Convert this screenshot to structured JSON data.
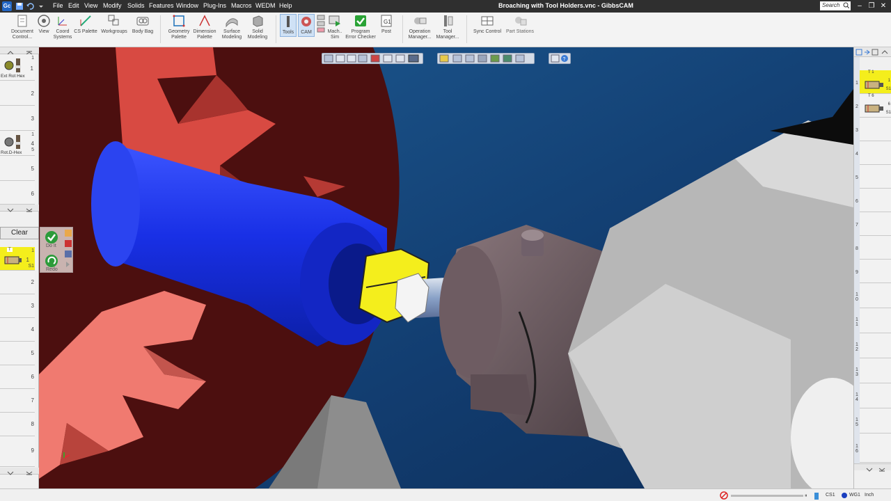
{
  "app": {
    "title": "Broaching with Tool Holders.vnc - GibbsCAM"
  },
  "menu": [
    "File",
    "Edit",
    "View",
    "Modify",
    "Solids",
    "Features",
    "Window",
    "Plug-Ins",
    "Macros",
    "WEDM",
    "Help"
  ],
  "search": {
    "placeholder": "Search"
  },
  "ribbon": {
    "tools": [
      {
        "label1": "Document",
        "label2": "Control...",
        "icon": "document-control-icon"
      },
      {
        "label1": "View",
        "label2": "",
        "icon": "view-icon"
      },
      {
        "label1": "Coord",
        "label2": "Systems",
        "icon": "coord-systems-icon"
      },
      {
        "label1": "CS Palette",
        "label2": "",
        "icon": "cs-palette-icon"
      },
      {
        "label1": "Workgroups",
        "label2": "",
        "icon": "workgroups-icon"
      },
      {
        "label1": "Body Bag",
        "label2": "",
        "icon": "body-bag-icon"
      },
      {
        "label1": "Geometry",
        "label2": "Palette",
        "icon": "geometry-palette-icon"
      },
      {
        "label1": "Dimension",
        "label2": "Palette",
        "icon": "dimension-palette-icon"
      },
      {
        "label1": "Surface",
        "label2": "Modeling",
        "icon": "surface-modeling-icon"
      },
      {
        "label1": "Solid",
        "label2": "Modeling",
        "icon": "solid-modeling-icon"
      },
      {
        "label1": "Tools",
        "label2": "",
        "icon": "tools-icon"
      },
      {
        "label1": "CAM",
        "label2": "",
        "icon": "cam-icon"
      },
      {
        "label1": "Mach..",
        "label2": "Sim",
        "icon": "machine-sim-icon"
      },
      {
        "label1": "Program",
        "label2": "Error Checker",
        "icon": "program-error-checker-icon"
      },
      {
        "label1": "Post",
        "label2": "",
        "icon": "post-icon"
      },
      {
        "label1": "Operation",
        "label2": "Manager...",
        "icon": "operation-manager-icon"
      },
      {
        "label1": "Tool",
        "label2": "Manager...",
        "icon": "tool-manager-icon"
      },
      {
        "label1": "Sync Control",
        "label2": "",
        "icon": "sync-control-icon"
      },
      {
        "label1": "Part Stations",
        "label2": "",
        "icon": "part-stations-icon"
      }
    ]
  },
  "left_tools": {
    "slots": [
      {
        "num": "1",
        "tool_label": "Ext Rot Hex",
        "small_num": "1"
      },
      {
        "num": "2"
      },
      {
        "num": "3"
      },
      {
        "num": "4",
        "tool_label": "Rot.D-Hex",
        "small_nums": [
          "1",
          "5"
        ]
      },
      {
        "num": "5"
      },
      {
        "num": "6"
      }
    ]
  },
  "process": {
    "clear_label": "Clear",
    "doit_label": "Do It",
    "redo_label": "Redo",
    "slots": [
      "1",
      "2",
      "3",
      "4",
      "5",
      "6",
      "7",
      "8",
      "9"
    ],
    "item": {
      "top": "T",
      "num": "1",
      "side": "1",
      "s": "S1"
    }
  },
  "right_tools": {
    "slots": [
      {
        "num": "1",
        "t": "T 1",
        "sub": "1",
        "s": "S1"
      },
      {
        "num": "2",
        "t": "T 6",
        "sub": "6",
        "s": "S1"
      },
      {
        "num": "3"
      },
      {
        "num": "4"
      },
      {
        "num": "5"
      },
      {
        "num": "6"
      },
      {
        "num": "7"
      },
      {
        "num": "8"
      },
      {
        "num": "9"
      },
      {
        "num": "1\n0"
      },
      {
        "num": "1\n1"
      },
      {
        "num": "1\n2"
      },
      {
        "num": "1\n3"
      },
      {
        "num": "1\n4"
      },
      {
        "num": "1\n5"
      },
      {
        "num": "1\n6"
      }
    ]
  },
  "status": {
    "cs": "CS1",
    "wg": "WG1",
    "unit": "Inch"
  },
  "colors": {
    "accent": "#0078d7",
    "viewport_bg": "#123f74",
    "part": "#1a2fe0",
    "fixture": "#d84a42",
    "chuck": "#4c0f0f",
    "highlight": "#f4ee1c"
  }
}
